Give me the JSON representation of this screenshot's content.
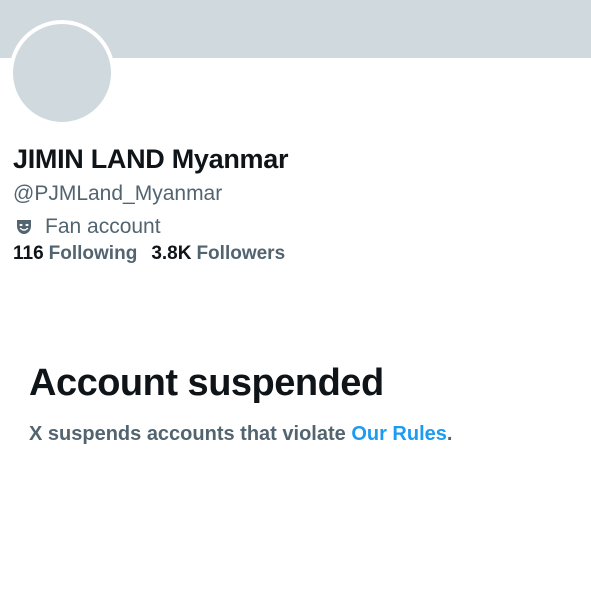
{
  "profile": {
    "display_name": "JIMIN LAND Myanmar",
    "handle": "@PJMLand_Myanmar",
    "category": {
      "icon": "fan-account-mask-icon",
      "label": "Fan account"
    },
    "stats": {
      "following_count": "116",
      "following_label": "Following",
      "followers_count": "3.8K",
      "followers_label": "Followers"
    }
  },
  "notice": {
    "title": "Account suspended",
    "body_prefix": "X suspends accounts that violate ",
    "link_text": "Our Rules",
    "body_suffix": "."
  },
  "colors": {
    "banner": "#cfd9de",
    "avatar_placeholder": "#cfd9de",
    "primary_text": "#0f1419",
    "secondary_text": "#536471",
    "link": "#1d9bf0"
  }
}
